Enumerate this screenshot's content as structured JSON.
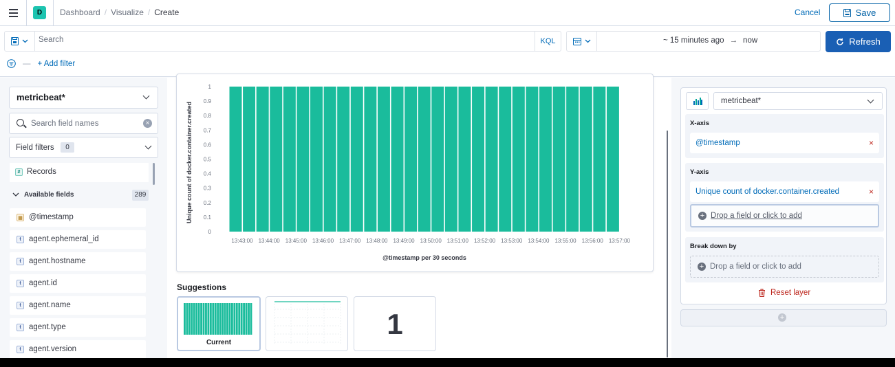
{
  "header": {
    "space_initial": "D",
    "breadcrumbs": [
      "Dashboard",
      "Visualize",
      "Create"
    ],
    "cancel_label": "Cancel",
    "save_label": "Save"
  },
  "query": {
    "search_placeholder": "Search",
    "language": "KQL",
    "time_from": "~ 15 minutes ago",
    "time_arrow": "→",
    "time_to": "now",
    "refresh_label": "Refresh",
    "add_filter_label": "+ Add filter",
    "filter_dash": "—"
  },
  "sidebar": {
    "index_pattern": "metricbeat*",
    "field_search_placeholder": "Search field names",
    "field_filters_label": "Field filters",
    "field_filters_count": "0",
    "records_label": "Records",
    "available_fields_label": "Available fields",
    "available_fields_count": "289",
    "fields": [
      {
        "name": "@timestamp",
        "type": "date"
      },
      {
        "name": "agent.ephemeral_id",
        "type": "string"
      },
      {
        "name": "agent.hostname",
        "type": "string"
      },
      {
        "name": "agent.id",
        "type": "string"
      },
      {
        "name": "agent.name",
        "type": "string"
      },
      {
        "name": "agent.type",
        "type": "string"
      },
      {
        "name": "agent.version",
        "type": "string"
      }
    ]
  },
  "chart_data": {
    "type": "bar",
    "xlabel": "@timestamp per 30 seconds",
    "ylabel": "Unique count of docker.container.created",
    "ylim": [
      0,
      1
    ],
    "yticks": [
      "1",
      "0.9",
      "0.8",
      "0.7",
      "0.6",
      "0.5",
      "0.4",
      "0.3",
      "0.2",
      "0.1",
      "0"
    ],
    "xticks": [
      "13:43:00",
      "13:44:00",
      "13:45:00",
      "13:46:00",
      "13:47:00",
      "13:48:00",
      "13:49:00",
      "13:50:00",
      "13:51:00",
      "13:52:00",
      "13:53:00",
      "13:54:00",
      "13:55:00",
      "13:56:00",
      "13:57:00"
    ],
    "values": [
      1,
      1,
      1,
      1,
      1,
      1,
      1,
      1,
      1,
      1,
      1,
      1,
      1,
      1,
      1,
      1,
      1,
      1,
      1,
      1,
      1,
      1,
      1,
      1,
      1,
      1,
      1,
      1,
      1
    ],
    "bar_color": "#1abc9c",
    "grid": true
  },
  "suggestions": {
    "title": "Suggestions",
    "current_label": "Current",
    "metric_value": "1"
  },
  "layer": {
    "index_pattern": "metricbeat*",
    "x_axis_title": "X-axis",
    "x_axis_field": "@timestamp",
    "y_axis_title": "Y-axis",
    "y_axis_field": "Unique count of docker.container.created",
    "drop_label": "Drop a field or click to add",
    "breakdown_title": "Break down by",
    "breakdown_drop_label": "Drop a field or click to add",
    "reset_label": "Reset layer",
    "remove_glyph": "×"
  },
  "colors": {
    "accent": "#006bb8",
    "primary_button": "#1a5fb4",
    "danger": "#bd271e",
    "bar": "#1abc9c"
  }
}
